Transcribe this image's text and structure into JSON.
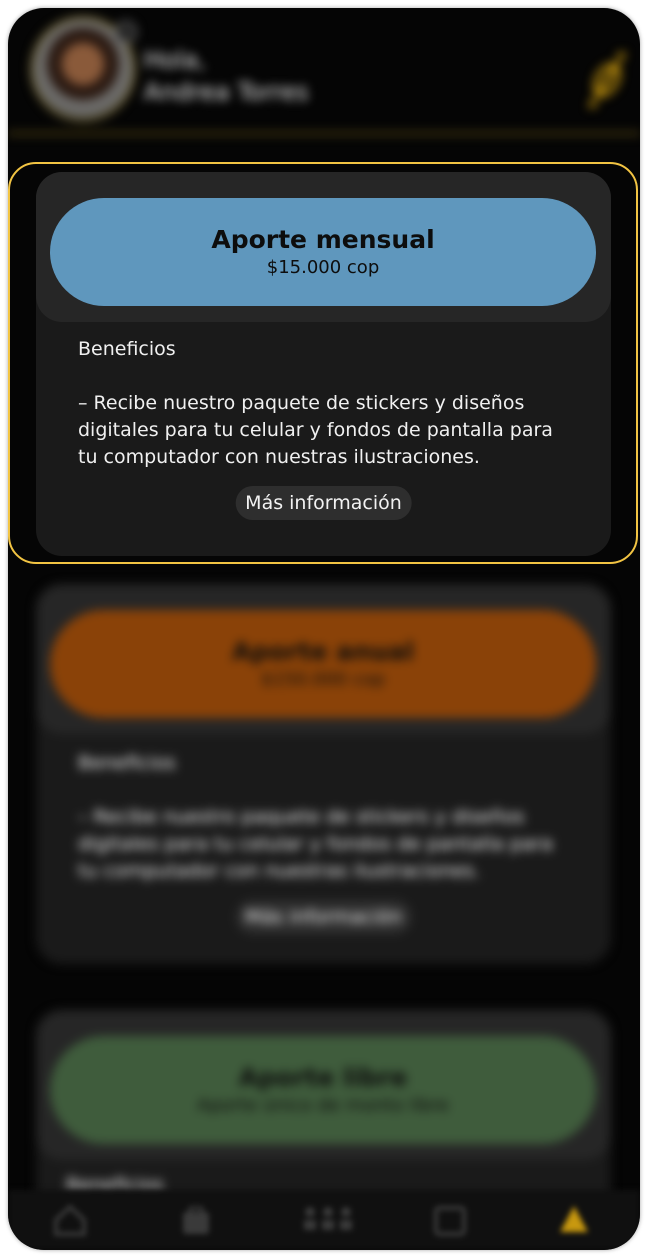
{
  "header": {
    "greeting": "Hola,",
    "user_name": "Andrea Torres",
    "avatar_icon": "avatar",
    "menu_icon": "candy-icon"
  },
  "cards": [
    {
      "title": "Aporte mensual",
      "price": "$15.000 cop",
      "color": "#5f97bd",
      "benefits_label": "Beneficios",
      "benefits_text": "– Recibe nuestro paquete de stickers y diseños digitales para tu celular y fondos de pantalla para tu computador con nuestras ilustraciones.",
      "more_label": "Más información"
    },
    {
      "title": "Aporte anual",
      "price": "$150.000 cop",
      "color": "#8a4208",
      "benefits_label": "Beneficios",
      "benefits_text": "– Recibe nuestro paquete de stickers y diseños digitales para tu celular y fondos de pantalla para tu computador con nuestras ilustraciones.",
      "more_label": "Más información"
    },
    {
      "title": "Aporte libre",
      "price": "Aporte único de monto libre",
      "color": "#3f5c3c",
      "benefits_label": "Beneficios"
    }
  ],
  "nav": {
    "items": [
      "home-icon",
      "bag-icon",
      "community-icon",
      "calendar-icon",
      "support-icon"
    ],
    "active_color": "#c8980f"
  }
}
